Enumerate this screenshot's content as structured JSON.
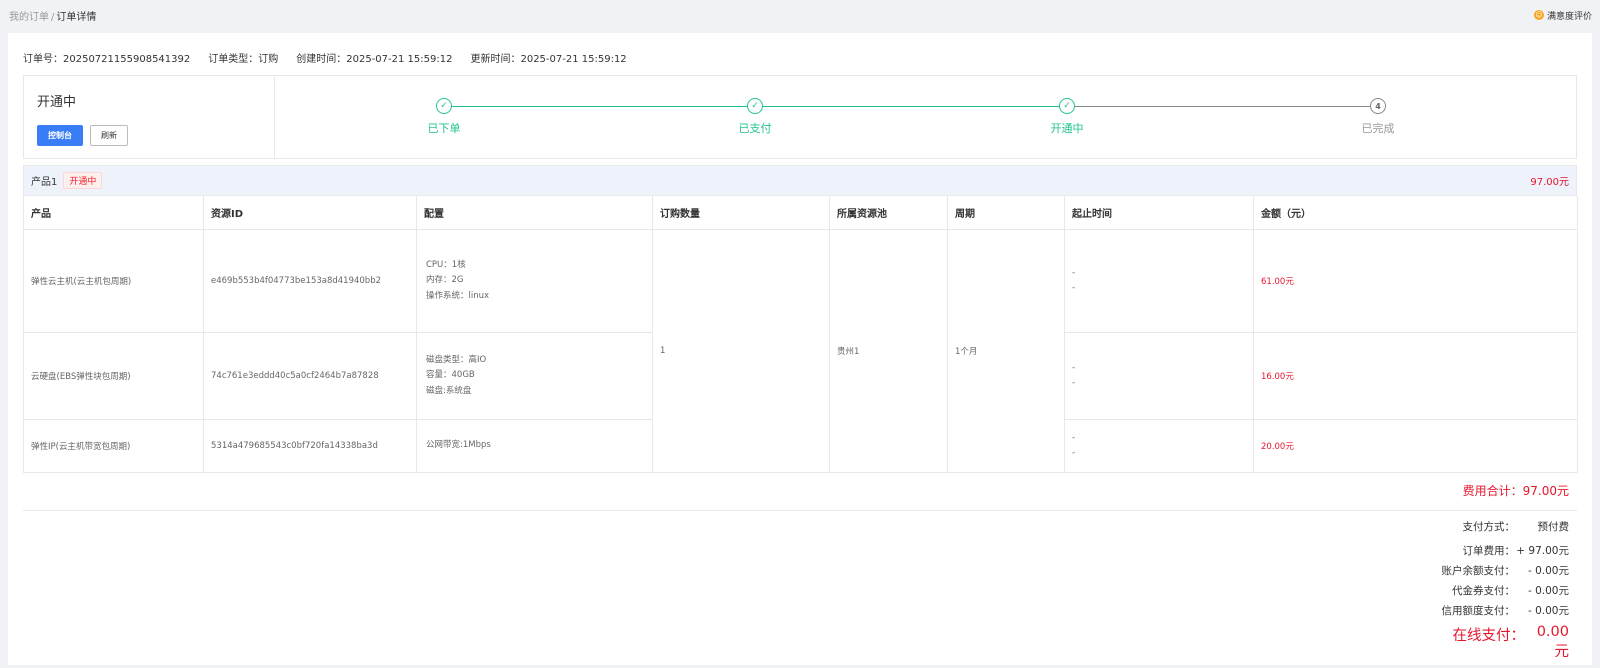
{
  "breadcrumb": {
    "parent": "我的订单",
    "separator": "/",
    "current": "订单详情"
  },
  "satisfaction": {
    "label": "满意度评价",
    "icon": "smile-icon",
    "color": "#f5a623"
  },
  "meta": {
    "order_no": "订单号：20250721155908541392",
    "order_type": "订单类型：订购",
    "created": "创建时间：2025-07-21 15:59:12",
    "updated": "更新时间：2025-07-21 15:59:12"
  },
  "status": {
    "title": "开通中",
    "console_button": "控制台",
    "refresh_button": "刷新"
  },
  "steps": [
    {
      "label": "已下单",
      "state": "done",
      "symbol": "✓"
    },
    {
      "label": "已支付",
      "state": "done",
      "symbol": "✓"
    },
    {
      "label": "开通中",
      "state": "done",
      "symbol": "✓"
    },
    {
      "label": "已完成",
      "state": "pending",
      "symbol": "4"
    }
  ],
  "product": {
    "name": "产品1",
    "tag": "开通中",
    "price": "97.00元"
  },
  "table": {
    "headers": [
      "产品",
      "资源ID",
      "配置",
      "订购数量",
      "所属资源池",
      "周期",
      "起止时间",
      "金额（元）"
    ],
    "quantity": "1",
    "pool": "贵州1",
    "period": "1个月",
    "rows": [
      {
        "product": "弹性云主机(云主机包周期)",
        "resource_id": "e469b553b4f04773be153a8d41940bb2",
        "config": [
          "CPU：1核",
          "内存：2G",
          "操作系统：linux"
        ],
        "range": [
          "-",
          "-"
        ],
        "amount": "61.00元"
      },
      {
        "product": "云硬盘(EBS弹性块包周期)",
        "resource_id": "74c761e3eddd40c5a0cf2464b7a87828",
        "config": [
          "磁盘类型：高IO",
          "容量：40GB",
          "磁盘:系统盘"
        ],
        "range": [
          "-",
          "-"
        ],
        "amount": "16.00元"
      },
      {
        "product": "弹性IP(云主机带宽包周期)",
        "resource_id": "5314a479685543c0bf720fa14338ba3d",
        "config": [
          "公网带宽:1Mbps"
        ],
        "range": [
          "-",
          "-"
        ],
        "amount": "20.00元"
      }
    ]
  },
  "total": "费用合计：97.00元",
  "summary": {
    "pay_method_label": "支付方式：",
    "pay_method_value": "预付费",
    "order_fee_label": "订单费用：",
    "order_fee_value": "+ 97.00元",
    "balance_label": "账户余额支付：",
    "balance_value": "- 0.00元",
    "voucher_label": "代金券支付：",
    "voucher_value": "- 0.00元",
    "credit_label": "信用额度支付：",
    "credit_value": "- 0.00元",
    "online_label": "在线支付：",
    "online_value": "0.00元"
  },
  "colors": {
    "accent": "#3a7ef7",
    "success": "#21c48f",
    "price": "#e6162d",
    "header_bg": "#eef2fb"
  }
}
